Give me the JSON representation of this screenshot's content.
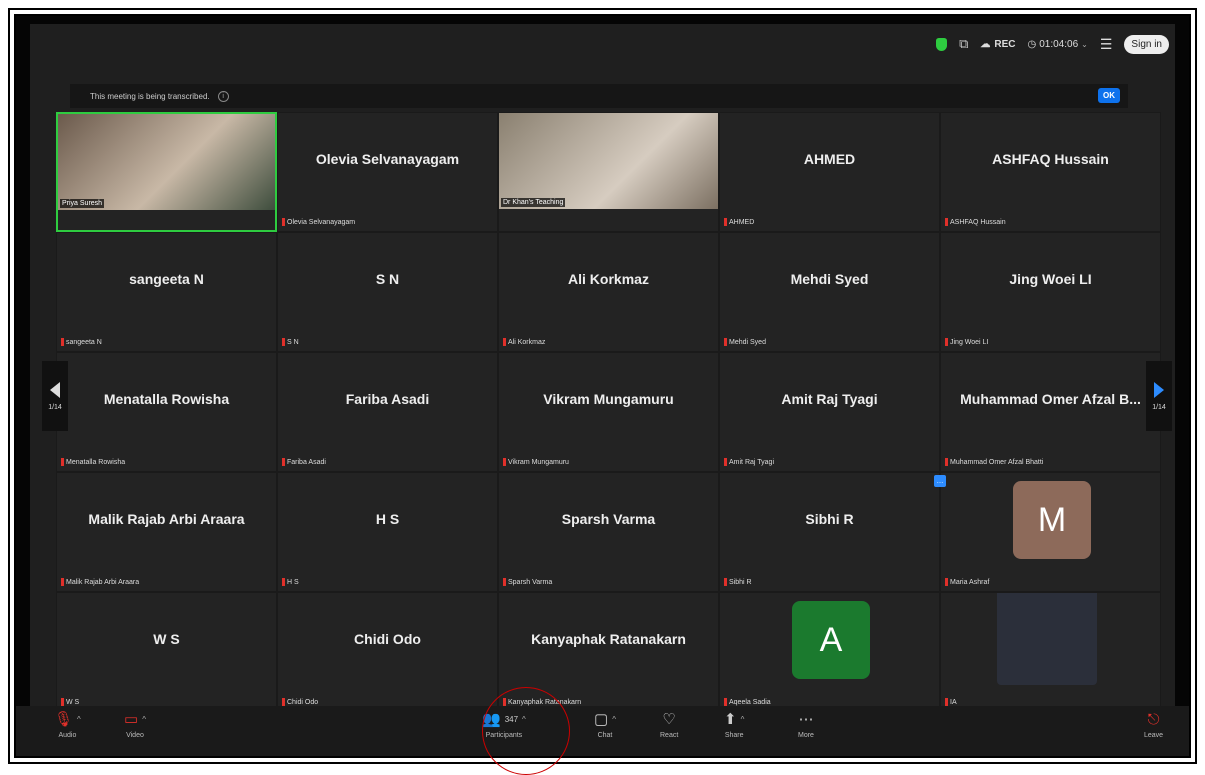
{
  "topbar": {
    "rec_label": "REC",
    "timer": "01:04:06",
    "signin": "Sign in"
  },
  "banner": {
    "text": "This meeting is being transcribed.",
    "ok": "OK"
  },
  "pager": {
    "left": "1/14",
    "right": "1/14"
  },
  "tiles": [
    {
      "name": "",
      "label": "Priya Suresh",
      "type": "video"
    },
    {
      "name": "Olevia Selvanayagam",
      "label": "Olevia Selvanayagam"
    },
    {
      "name": "",
      "label": "Dr Khan's Teaching",
      "type": "video"
    },
    {
      "name": "AHMED",
      "label": "AHMED"
    },
    {
      "name": "ASHFAQ Hussain",
      "label": "ASHFAQ Hussain"
    },
    {
      "name": "sangeeta N",
      "label": "sangeeta N"
    },
    {
      "name": "S N",
      "label": "S N"
    },
    {
      "name": "Ali Korkmaz",
      "label": "Ali Korkmaz"
    },
    {
      "name": "Mehdi Syed",
      "label": "Mehdi Syed"
    },
    {
      "name": "Jing Woei LI",
      "label": "Jing Woei LI"
    },
    {
      "name": "Menatalla Rowisha",
      "label": "Menatalla Rowisha"
    },
    {
      "name": "Fariba Asadi",
      "label": "Fariba Asadi"
    },
    {
      "name": "Vikram Mungamuru",
      "label": "Vikram Mungamuru"
    },
    {
      "name": "Amit Raj Tyagi",
      "label": "Amit Raj Tyagi"
    },
    {
      "name": "Muhammad Omer Afzal B...",
      "label": "Muhammad Omer Afzal Bhatti"
    },
    {
      "name": "Malik Rajab Arbi Araara",
      "label": "Malik Rajab Arbi Araara"
    },
    {
      "name": "H S",
      "label": "H S"
    },
    {
      "name": "Sparsh Varma",
      "label": "Sparsh Varma"
    },
    {
      "name": "Sibhi R",
      "label": "Sibhi R"
    },
    {
      "name": "",
      "label": "Maria Ashraf",
      "type": "avatar",
      "letter": "M",
      "color": "#8d6a5a"
    },
    {
      "name": "W S",
      "label": "W S"
    },
    {
      "name": "Chidi Odo",
      "label": "Chidi Odo"
    },
    {
      "name": "Kanyaphak Ratanakarn",
      "label": "Kanyaphak Ratanakarn"
    },
    {
      "name": "",
      "label": "Aqeela Sadia",
      "type": "avatar",
      "letter": "A",
      "color": "#1b7a2e"
    },
    {
      "name": "",
      "label": "IA",
      "type": "blank"
    }
  ],
  "bottombar": {
    "audio": "Audio",
    "video": "Video",
    "participants": "Participants",
    "participants_count": "347",
    "chat": "Chat",
    "react": "React",
    "share": "Share",
    "more": "More",
    "leave": "Leave"
  }
}
